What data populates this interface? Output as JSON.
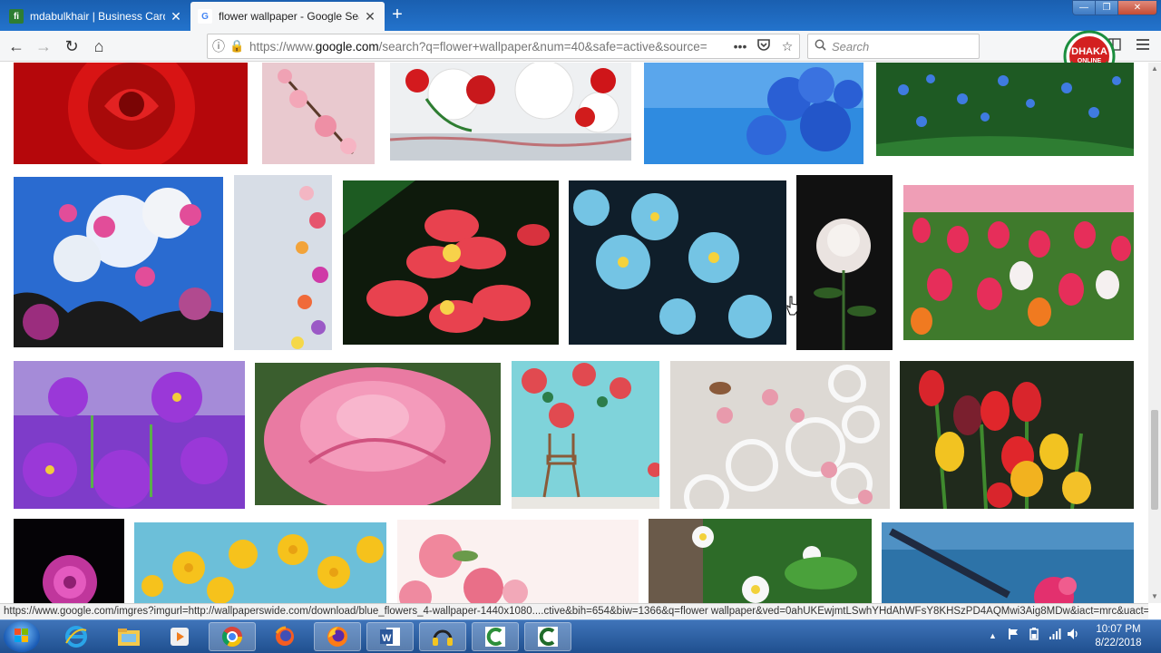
{
  "tabs": [
    {
      "title": "mdabulkhair | Business Cards & L",
      "favicon": "fiverr-icon",
      "close": "✕"
    },
    {
      "title": "flower wallpaper - Google Search",
      "favicon": "google-icon",
      "close": "✕"
    }
  ],
  "new_tab": "+",
  "window_controls": {
    "minimize": "—",
    "maximize": "❐",
    "close": "✕"
  },
  "nav": {
    "back": "←",
    "forward": "→",
    "reload": "↻",
    "home": "⌂"
  },
  "url": {
    "prefix": "https://www.",
    "host": "google.com",
    "rest": "/search?q=flower+wallpaper&num=40&safe=active&source=",
    "info": "ⓘ",
    "lock": "🔒"
  },
  "url_actions": {
    "more": "•••",
    "pocket": "◙",
    "star": "☆"
  },
  "search": {
    "placeholder": "Search",
    "icon": "⌕"
  },
  "side_icons": {
    "library": "|||\\",
    "sidebar": "▥",
    "menu": "≡"
  },
  "logo": {
    "line1": "DHAKA",
    "line2": "ONLINE"
  },
  "status_url": "https://www.google.com/imgres?imgurl=http://wallpaperswide.com/download/blue_flowers_4-wallpaper-1440x1080....ctive&bih=654&biw=1366&q=flower wallpaper&ved=0ahUKEwjmtLSwhYHdAhWFsY8KHSzPD4AQMwi3Aig8MDw&iact=mrc&uact=8",
  "scrollbar": {
    "up": "▲",
    "down": "▼"
  },
  "taskbar": {
    "apps": [
      "internet-explorer-icon",
      "file-explorer-icon",
      "media-player-icon",
      "chrome-icon",
      "firefox-alt-icon",
      "firefox-icon",
      "word-icon",
      "headphones-app-icon",
      "camtasia-icon",
      "camtasia-alt-icon"
    ],
    "tray_arrow": "▲",
    "clock_time": "10:07 PM",
    "clock_date": "8/22/2018"
  },
  "colors": {
    "tabbar": "#1a5fb0",
    "lock": "#12a70e",
    "taskbar": "#2b5c9e"
  }
}
